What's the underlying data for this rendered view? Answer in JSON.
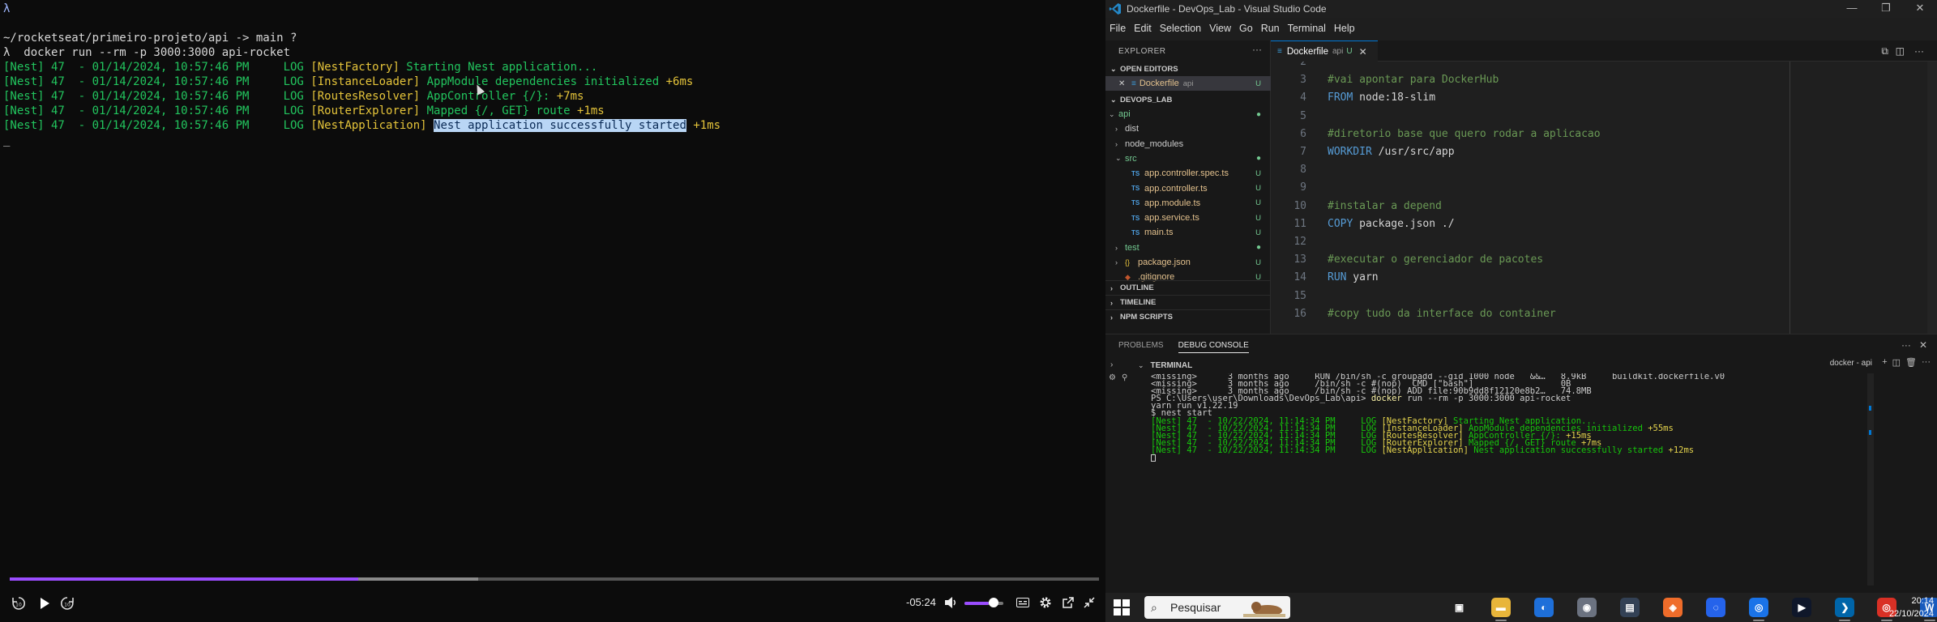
{
  "left_video": {
    "prompt_lambda": "λ",
    "prompt_path": "~/rocketseat/primeiro-projeto/api -> main ?",
    "command": "λ  docker run --rm -p 3000:3000 api-rocket",
    "log_lines": [
      {
        "prefix": "[Nest] 47  - 01/14/2024, 10:57:46 PM     LOG ",
        "ctx": "[NestFactory]",
        "msg": " Starting Nest application...",
        "time": ""
      },
      {
        "prefix": "[Nest] 47  - 01/14/2024, 10:57:46 PM     LOG ",
        "ctx": "[InstanceLoader]",
        "msg": " AppModule dependencies initialized",
        "time": " +6ms"
      },
      {
        "prefix": "[Nest] 47  - 01/14/2024, 10:57:46 PM     LOG ",
        "ctx": "[RoutesResolver]",
        "msg": " AppController {/}:",
        "time": " +7ms"
      },
      {
        "prefix": "[Nest] 47  - 01/14/2024, 10:57:46 PM     LOG ",
        "ctx": "[RouterExplorer]",
        "msg": " Mapped {/, GET} route",
        "time": " +1ms"
      },
      {
        "prefix": "[Nest] 47  - 01/14/2024, 10:57:46 PM     LOG ",
        "ctx": "[NestApplication]",
        "msg": "Nest application successfully started",
        "time": " +1ms"
      }
    ],
    "cursor_line": "_",
    "time_remaining": "-05:24",
    "progress_played_fraction": 0.32,
    "progress_buffered_fraction": 0.43,
    "volume_fraction": 0.62,
    "controls": {
      "rewind_icon": "rewind-10-icon",
      "play_icon": "play-icon",
      "forward_icon": "forward-10-icon",
      "volume_icon": "speaker-icon",
      "captions_icon": "captions-icon",
      "settings_icon": "gear-icon",
      "external_icon": "open-external-icon",
      "fullscreen_icon": "exit-fullscreen-icon"
    }
  },
  "vscode": {
    "window_title": "Dockerfile - DevOps_Lab - Visual Studio Code",
    "window_buttons": [
      "—",
      "❐",
      "✕"
    ],
    "menu": [
      "File",
      "Edit",
      "Selection",
      "View",
      "Go",
      "Run",
      "Terminal",
      "Help"
    ],
    "explorer_title": "EXPLORER",
    "explorer_more": "···",
    "open_editors_label": "OPEN EDITORS",
    "open_editor": {
      "close": "✕",
      "name": "Dockerfile",
      "sub": "api",
      "badge": "U"
    },
    "workspace_label": "DEVOPS_LAB",
    "tree": [
      {
        "indent": 1,
        "chev": "⌄",
        "icon": "",
        "label": "api",
        "badge": "●",
        "kind": "dir-green"
      },
      {
        "indent": 2,
        "chev": "›",
        "icon": "",
        "label": "dist",
        "badge": "",
        "kind": "dir"
      },
      {
        "indent": 2,
        "chev": "›",
        "icon": "",
        "label": "node_modules",
        "badge": "",
        "kind": "dir"
      },
      {
        "indent": 2,
        "chev": "⌄",
        "icon": "",
        "label": "src",
        "badge": "●",
        "kind": "dir-green"
      },
      {
        "indent": 3,
        "chev": "",
        "icon": "TS",
        "label": "app.controller.spec.ts",
        "badge": "U",
        "kind": "file"
      },
      {
        "indent": 3,
        "chev": "",
        "icon": "TS",
        "label": "app.controller.ts",
        "badge": "U",
        "kind": "file"
      },
      {
        "indent": 3,
        "chev": "",
        "icon": "TS",
        "label": "app.module.ts",
        "badge": "U",
        "kind": "file"
      },
      {
        "indent": 3,
        "chev": "",
        "icon": "TS",
        "label": "app.service.ts",
        "badge": "U",
        "kind": "file"
      },
      {
        "indent": 3,
        "chev": "",
        "icon": "TS",
        "label": "main.ts",
        "badge": "U",
        "kind": "file"
      },
      {
        "indent": 2,
        "chev": "›",
        "icon": "",
        "label": "test",
        "badge": "●",
        "kind": "dir-green"
      },
      {
        "indent": 2,
        "chev": "›",
        "icon": "{}",
        "label": "package.json",
        "badge": "U",
        "kind": "file"
      },
      {
        "indent": 2,
        "chev": "",
        "icon": "◆",
        "label": ".gitignore",
        "badge": "U",
        "kind": "file"
      }
    ],
    "outline_label": "OUTLINE",
    "timeline_label": "TIMELINE",
    "npm_label": "NPM SCRIPTS",
    "tab": {
      "name": "Dockerfile",
      "sub": "api",
      "badge": "U",
      "close": "✕"
    },
    "code_lines": [
      {
        "n": "2",
        "parts": []
      },
      {
        "n": "3",
        "parts": [
          {
            "t": "#vai apontar para DockerHub",
            "c": "comment"
          }
        ]
      },
      {
        "n": "4",
        "parts": [
          {
            "t": "FROM",
            "c": "kw"
          },
          {
            "t": " node:18-slim",
            "c": "id"
          }
        ]
      },
      {
        "n": "5",
        "parts": []
      },
      {
        "n": "6",
        "parts": [
          {
            "t": "#diretorio base que quero rodar a aplicacao",
            "c": "comment"
          }
        ]
      },
      {
        "n": "7",
        "parts": [
          {
            "t": "WORKDIR",
            "c": "kw"
          },
          {
            "t": " /usr/src/app",
            "c": "id"
          }
        ]
      },
      {
        "n": "8",
        "parts": []
      },
      {
        "n": "9",
        "parts": []
      },
      {
        "n": "10",
        "parts": [
          {
            "t": "#instalar a depend",
            "c": "comment"
          }
        ]
      },
      {
        "n": "11",
        "parts": [
          {
            "t": "COPY",
            "c": "kw"
          },
          {
            "t": " package.json ./",
            "c": "id"
          }
        ]
      },
      {
        "n": "12",
        "parts": []
      },
      {
        "n": "13",
        "parts": [
          {
            "t": "#executar o gerenciador de pacotes",
            "c": "comment"
          }
        ]
      },
      {
        "n": "14",
        "parts": [
          {
            "t": "RUN",
            "c": "kw"
          },
          {
            "t": " yarn",
            "c": "id"
          }
        ]
      },
      {
        "n": "15",
        "parts": []
      },
      {
        "n": "16",
        "parts": [
          {
            "t": "#copy tudo da interface do container",
            "c": "comment"
          }
        ]
      }
    ],
    "panel_tabs": [
      "PROBLEMS",
      "DEBUG CONSOLE"
    ],
    "terminal_label": "TERMINAL",
    "terminal_instance": "docker - api",
    "terminal_lines": [
      {
        "parts": [
          {
            "t": "<missing>      3 months ago     RUN /bin/sh -c groupadd --gid 1000 node   &&…   8.9kB     buildkit.dockerfile.v0",
            "c": "w"
          }
        ]
      },
      {
        "parts": [
          {
            "t": "<missing>      3 months ago     /bin/sh -c #(nop)  CMD [\"bash\"]                 0B",
            "c": "w"
          }
        ]
      },
      {
        "parts": [
          {
            "t": "<missing>      3 months ago     /bin/sh -c #(nop) ADD file:90b9dd8f12120e8b2…   74.8MB",
            "c": "w"
          }
        ]
      },
      {
        "parts": [
          {
            "t": "PS C:\\Users\\user\\Downloads\\DevOps_Lab\\api> ",
            "c": "w"
          },
          {
            "t": "docker",
            "c": "cmd"
          },
          {
            "t": " run --rm -p 3000:3000 api-rocket",
            "c": "w"
          }
        ]
      },
      {
        "parts": [
          {
            "t": "yarn run v1.22.19",
            "c": "w"
          }
        ]
      },
      {
        "parts": [
          {
            "t": "$ nest start",
            "c": "w"
          }
        ]
      },
      {
        "parts": [
          {
            "t": "[Nest] 47  - 10/22/2024, 11:14:34 PM     LOG ",
            "c": "g"
          },
          {
            "t": "[NestFactory]",
            "c": "y"
          },
          {
            "t": " Starting Nest application...",
            "c": "g"
          }
        ]
      },
      {
        "parts": [
          {
            "t": "[Nest] 47  - 10/22/2024, 11:14:34 PM     LOG ",
            "c": "g"
          },
          {
            "t": "[InstanceLoader]",
            "c": "y"
          },
          {
            "t": " AppModule dependencies initialized ",
            "c": "g"
          },
          {
            "t": "+55ms",
            "c": "y"
          }
        ]
      },
      {
        "parts": [
          {
            "t": "[Nest] 47  - 10/22/2024, 11:14:34 PM     LOG ",
            "c": "g"
          },
          {
            "t": "[RoutesResolver]",
            "c": "y"
          },
          {
            "t": " AppController {/}: ",
            "c": "g"
          },
          {
            "t": "+15ms",
            "c": "y"
          }
        ]
      },
      {
        "parts": [
          {
            "t": "[Nest] 47  - 10/22/2024, 11:14:34 PM     LOG ",
            "c": "g"
          },
          {
            "t": "[RouterExplorer]",
            "c": "y"
          },
          {
            "t": " Mapped {/, GET} route ",
            "c": "g"
          },
          {
            "t": "+7ms",
            "c": "y"
          }
        ]
      },
      {
        "parts": [
          {
            "t": "[Nest] 47  - 10/22/2024, 11:14:34 PM     LOG ",
            "c": "g"
          },
          {
            "t": "[NestApplication]",
            "c": "y"
          },
          {
            "t": " Nest application successfully started ",
            "c": "g"
          },
          {
            "t": "+12ms",
            "c": "y"
          }
        ]
      }
    ]
  },
  "taskbar": {
    "search_placeholder": "Pesquisar",
    "apps": [
      {
        "name": "task-view",
        "glyph": "▣",
        "color": "#202020"
      },
      {
        "name": "file-explorer",
        "glyph": "▬",
        "color": "#e8b53a"
      },
      {
        "name": "app-blue-1",
        "glyph": "◐",
        "color": "#1e6fd9"
      },
      {
        "name": "app-gray",
        "glyph": "◉",
        "color": "#6b7280"
      },
      {
        "name": "app-dark",
        "glyph": "▤",
        "color": "#334155"
      },
      {
        "name": "app-postman",
        "glyph": "◈",
        "color": "#ef6c2a"
      },
      {
        "name": "app-blue-2",
        "glyph": "◌",
        "color": "#2563eb"
      },
      {
        "name": "chrome",
        "glyph": "◎",
        "color": "#1a73e8"
      },
      {
        "name": "terminal",
        "glyph": "▶",
        "color": "#0f172a"
      },
      {
        "name": "vscode",
        "glyph": "❯",
        "color": "#0065a9"
      },
      {
        "name": "chrome-2",
        "glyph": "◎",
        "color": "#d93025"
      },
      {
        "name": "word",
        "glyph": "W",
        "color": "#185abd"
      }
    ],
    "clock_time": "20:14",
    "clock_date": "22/10/2024"
  }
}
